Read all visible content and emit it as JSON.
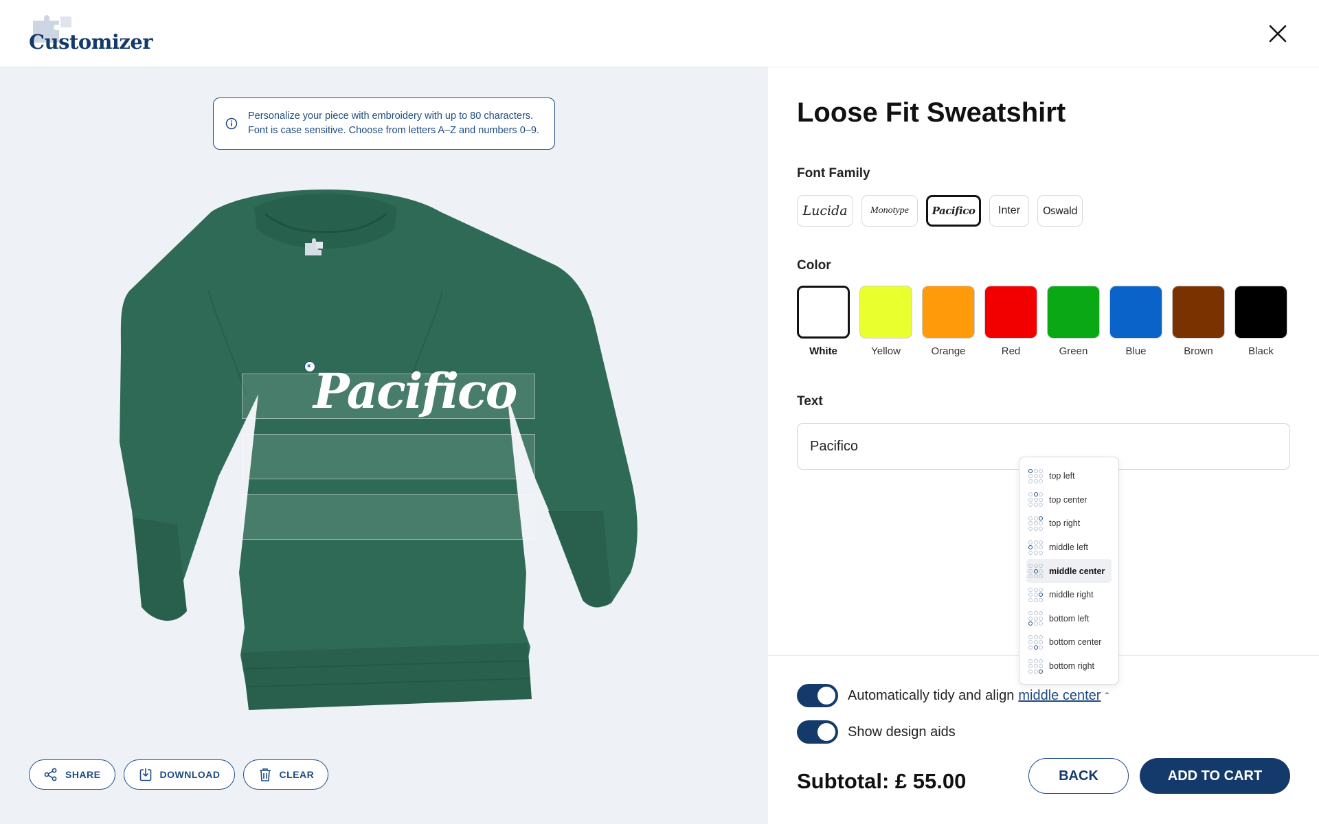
{
  "header": {
    "logo_text": "Customizer",
    "close_icon": "close-icon"
  },
  "preview": {
    "info": "Personalize your piece with embroidery with up to 80 characters.",
    "info_line2": "Font is case sensitive. Choose from letters A–Z and numbers 0–9.",
    "embroidery_text": "Pacifico",
    "garment_color": "#2e6a55",
    "actions": [
      {
        "label": "SHARE",
        "icon": "share-icon"
      },
      {
        "label": "DOWNLOAD",
        "icon": "download-icon"
      },
      {
        "label": "CLEAR",
        "icon": "trash-icon"
      }
    ]
  },
  "panel": {
    "product_title": "Loose Fit Sweatshirt",
    "font_family_label": "Font Family",
    "fonts": [
      {
        "label": "Lucida"
      },
      {
        "label": "Monotype"
      },
      {
        "label": "Pacifico",
        "selected": true
      },
      {
        "label": "Inter"
      },
      {
        "label": "Oswald"
      }
    ],
    "color_label": "Color",
    "colors": [
      {
        "label": "White",
        "hex": "#ffffff",
        "selected": true
      },
      {
        "label": "Yellow",
        "hex": "#eaff2e"
      },
      {
        "label": "Orange",
        "hex": "#ff9a0a"
      },
      {
        "label": "Red",
        "hex": "#f20000"
      },
      {
        "label": "Green",
        "hex": "#0aa814"
      },
      {
        "label": "Blue",
        "hex": "#0a63c9"
      },
      {
        "label": "Brown",
        "hex": "#7a3300"
      },
      {
        "label": "Black",
        "hex": "#000000"
      }
    ],
    "text_label": "Text",
    "text_value": "Pacifico",
    "toggles": {
      "tidy_label": "Automatically tidy and align",
      "tidy_value": "middle center",
      "design_aids_label": "Show design aids"
    },
    "subtotal": "Subtotal: £ 55.00",
    "back_label": "BACK",
    "cart_label": "ADD TO CART"
  },
  "alignment_options": [
    {
      "label": "top left"
    },
    {
      "label": "top center"
    },
    {
      "label": "top right"
    },
    {
      "label": "middle left"
    },
    {
      "label": "middle center",
      "selected": true
    },
    {
      "label": "middle right"
    },
    {
      "label": "bottom left"
    },
    {
      "label": "bottom center"
    },
    {
      "label": "bottom right"
    }
  ],
  "colors": {
    "brand": "#143a6b",
    "accent": "#1d4a80"
  }
}
